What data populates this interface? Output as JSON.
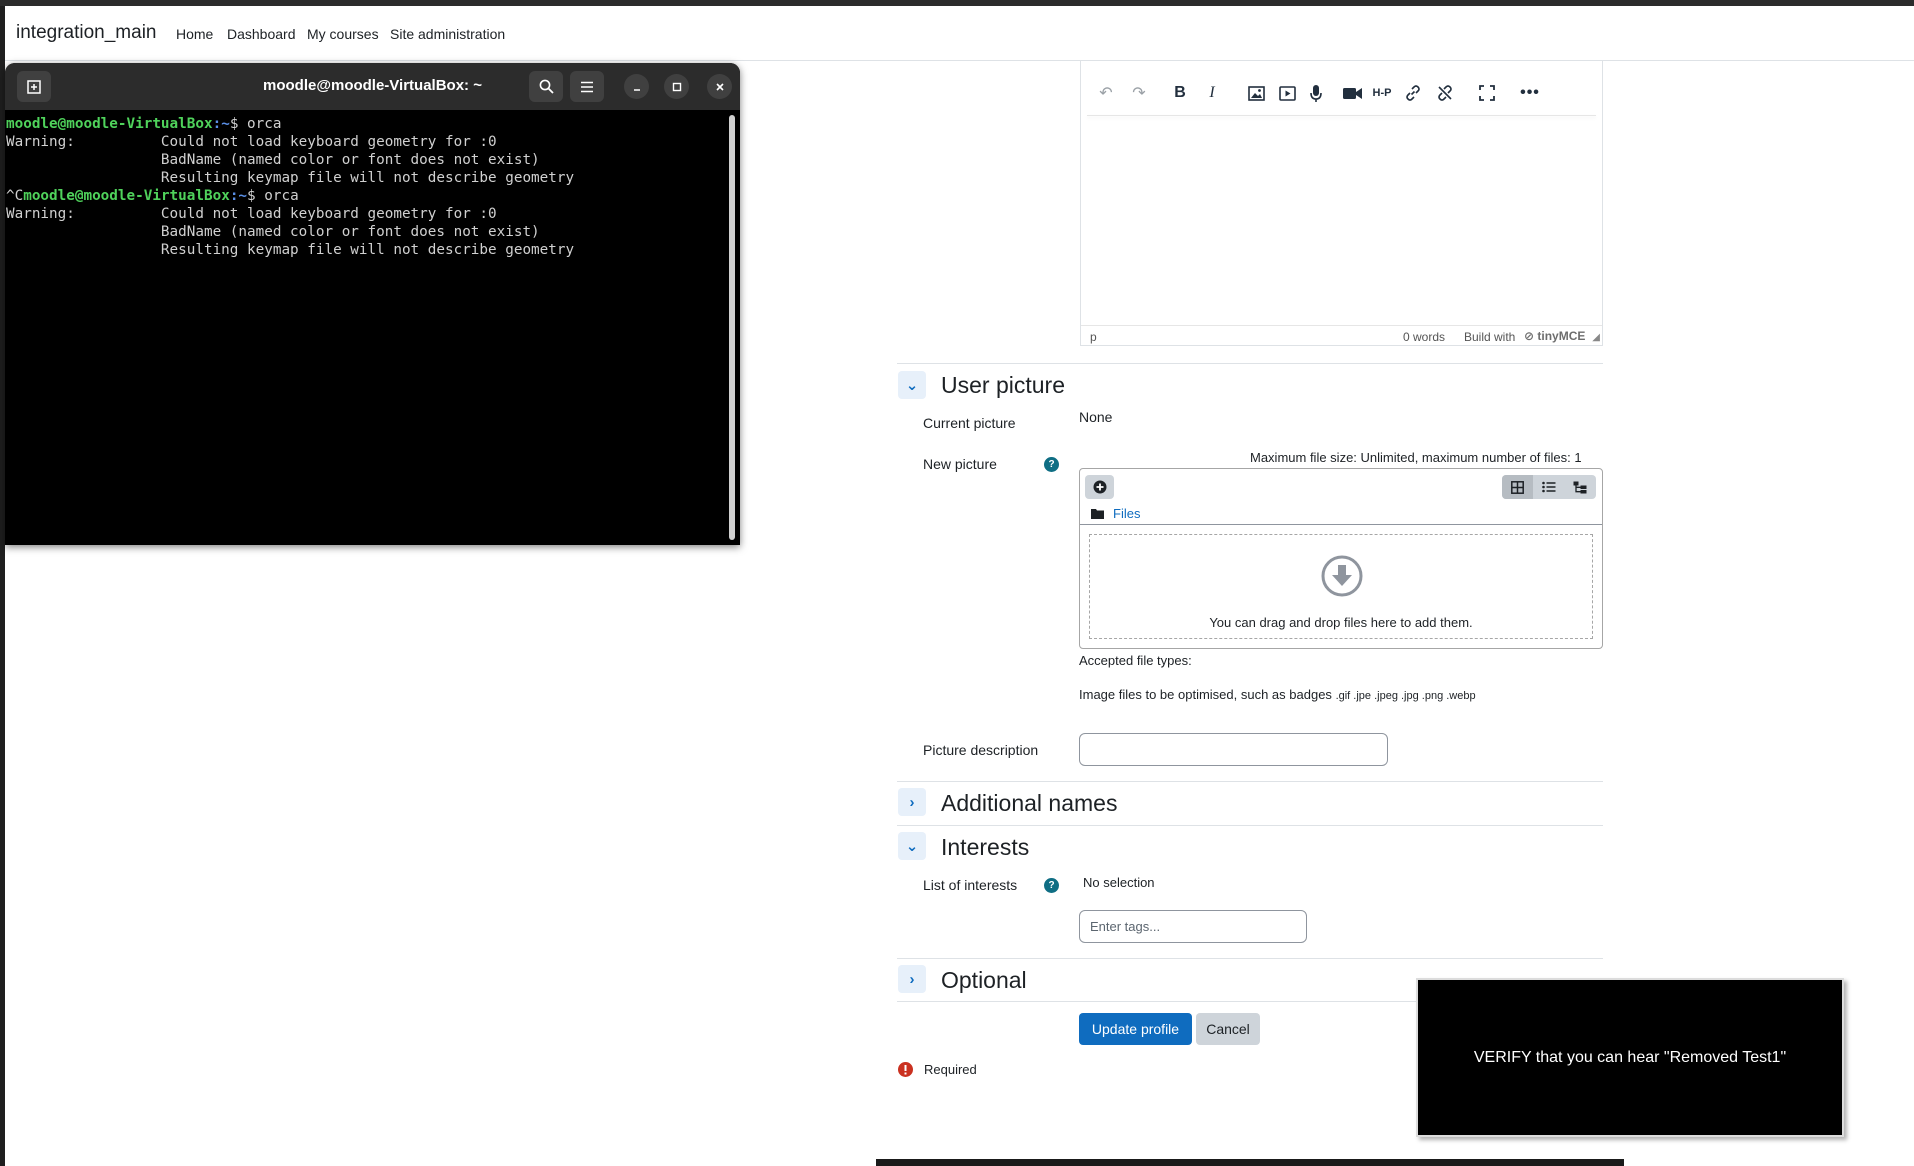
{
  "navbar": {
    "brand": "integration_main",
    "items": [
      "Home",
      "Dashboard",
      "My courses",
      "Site administration"
    ]
  },
  "terminal": {
    "title": "moodle@moodle-VirtualBox: ~",
    "prompt_user": "moodle@moodle-VirtualBox",
    "prompt_path": ":~",
    "lines": [
      {
        "prefix": "",
        "cmd": "$ orca"
      },
      {
        "text": "Warning:          Could not load keyboard geometry for :0"
      },
      {
        "text": "                  BadName (named color or font does not exist)"
      },
      {
        "text": "                  Resulting keymap file will not describe geometry"
      },
      {
        "prefix": "^C",
        "cmd": "$ orca"
      },
      {
        "text": "Warning:          Could not load keyboard geometry for :0"
      },
      {
        "text": "                  BadName (named color or font does not exist)"
      },
      {
        "text": "                  Resulting keymap file will not describe geometry"
      }
    ]
  },
  "editor": {
    "status_path": "p",
    "word_count": "0 words",
    "build_with": "Build with",
    "brand": "tinyMCE",
    "hp_label": "H-P"
  },
  "user_picture": {
    "title": "User picture",
    "current_label": "Current picture",
    "current_value": "None",
    "new_label": "New picture",
    "max_size": "Maximum file size: Unlimited, maximum number of files: 1",
    "files_link": "Files",
    "drop_text": "You can drag and drop files here to add them.",
    "accepted_label": "Accepted file types:",
    "accepted_desc": "Image files to be optimised, such as badges",
    "accepted_ext": ".gif .jpe .jpeg .jpg .png .webp",
    "desc_label": "Picture description",
    "desc_value": ""
  },
  "additional_names": {
    "title": "Additional names"
  },
  "interests": {
    "title": "Interests",
    "list_label": "List of interests",
    "no_selection": "No selection",
    "placeholder": "Enter tags..."
  },
  "optional": {
    "title": "Optional"
  },
  "actions": {
    "update": "Update profile",
    "cancel": "Cancel",
    "required": "Required"
  },
  "overlay": {
    "text": "VERIFY that you can hear \"Removed Test1\""
  },
  "colors": {
    "primary": "#0f6cbf",
    "terminal_prompt": "#4fd25b",
    "terminal_path": "#5a8fe6",
    "required": "#ca3120"
  }
}
